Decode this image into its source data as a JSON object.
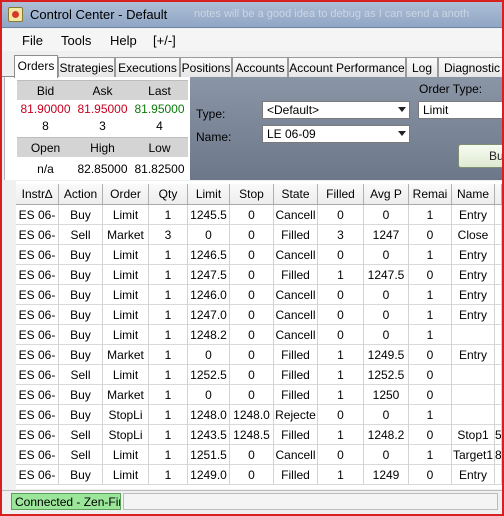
{
  "window": {
    "title": "Control Center - Default",
    "background_text": "notes will be a good idea to debug as I can send a anoth"
  },
  "menu": [
    "File",
    "Tools",
    "Help",
    "[+/-]"
  ],
  "tabs": [
    "Orders",
    "Strategies",
    "Executions",
    "Positions",
    "Accounts",
    "Account Performance",
    "Log",
    "Diagnostic"
  ],
  "quote": {
    "headers": [
      "Bid",
      "Ask",
      "Last"
    ],
    "prices": [
      "81.90000",
      "81.95000",
      "81.95000"
    ],
    "sizes": [
      "8",
      "3",
      "4"
    ],
    "headers2": [
      "Open",
      "High",
      "Low"
    ],
    "values2": [
      "n/a",
      "82.85000",
      "81.82500"
    ]
  },
  "order_entry": {
    "order_type_label": "Order Type:",
    "order_type_value": "Limit",
    "type_label": "Type:",
    "type_value": "<Default>",
    "name_label": "Name:",
    "name_value": "LE 06-09",
    "submit_label": "Bu"
  },
  "grid": {
    "columns": [
      "Instr∆",
      "Action",
      "Order",
      "Qty",
      "Limit",
      "Stop",
      "State",
      "Filled",
      "Avg P",
      "Remai",
      "Name"
    ],
    "rows": [
      [
        "ES 06-",
        "Buy",
        "Limit",
        "1",
        "1245.5",
        "0",
        "Cancell",
        "0",
        "0",
        "1",
        "Entry"
      ],
      [
        "ES 06-",
        "Sell",
        "Market",
        "3",
        "0",
        "0",
        "Filled",
        "3",
        "1247",
        "0",
        "Close"
      ],
      [
        "ES 06-",
        "Buy",
        "Limit",
        "1",
        "1246.5",
        "0",
        "Cancell",
        "0",
        "0",
        "1",
        "Entry"
      ],
      [
        "ES 06-",
        "Buy",
        "Limit",
        "1",
        "1247.5",
        "0",
        "Filled",
        "1",
        "1247.5",
        "0",
        "Entry"
      ],
      [
        "ES 06-",
        "Buy",
        "Limit",
        "1",
        "1246.0",
        "0",
        "Cancell",
        "0",
        "0",
        "1",
        "Entry"
      ],
      [
        "ES 06-",
        "Buy",
        "Limit",
        "1",
        "1247.0",
        "0",
        "Cancell",
        "0",
        "0",
        "1",
        "Entry"
      ],
      [
        "ES 06-",
        "Buy",
        "Limit",
        "1",
        "1248.2",
        "0",
        "Cancell",
        "0",
        "0",
        "1",
        ""
      ],
      [
        "ES 06-",
        "Buy",
        "Market",
        "1",
        "0",
        "0",
        "Filled",
        "1",
        "1249.5",
        "0",
        "Entry"
      ],
      [
        "ES 06-",
        "Sell",
        "Limit",
        "1",
        "1252.5",
        "0",
        "Filled",
        "1",
        "1252.5",
        "0",
        ""
      ],
      [
        "ES 06-",
        "Buy",
        "Market",
        "1",
        "0",
        "0",
        "Filled",
        "1",
        "1250",
        "0",
        ""
      ],
      [
        "ES 06-",
        "Buy",
        "StopLi",
        "1",
        "1248.0",
        "1248.0",
        "Rejecte",
        "0",
        "0",
        "1",
        ""
      ],
      [
        "ES 06-",
        "Sell",
        "StopLi",
        "1",
        "1243.5",
        "1248.5",
        "Filled",
        "1",
        "1248.2",
        "0",
        "Stop1"
      ],
      [
        "ES 06-",
        "Sell",
        "Limit",
        "1",
        "1251.5",
        "0",
        "Cancell",
        "0",
        "0",
        "1",
        "Target1"
      ],
      [
        "ES 06-",
        "Buy",
        "Limit",
        "1",
        "1249.0",
        "0",
        "Filled",
        "1",
        "1249",
        "0",
        "Entry"
      ]
    ],
    "extra_col_chars": [
      "",
      "",
      "",
      "",
      "",
      "",
      "",
      "",
      "",
      "",
      "",
      "5",
      "8",
      ""
    ]
  },
  "status": {
    "connection": "Connected - Zen-Fire"
  },
  "colors": {
    "bid_price": "#c8001e",
    "ask_price": "#c8001e",
    "last_price": "#0a7a0a",
    "connection_bg": "#9be69b",
    "window_border": "#d92020"
  }
}
